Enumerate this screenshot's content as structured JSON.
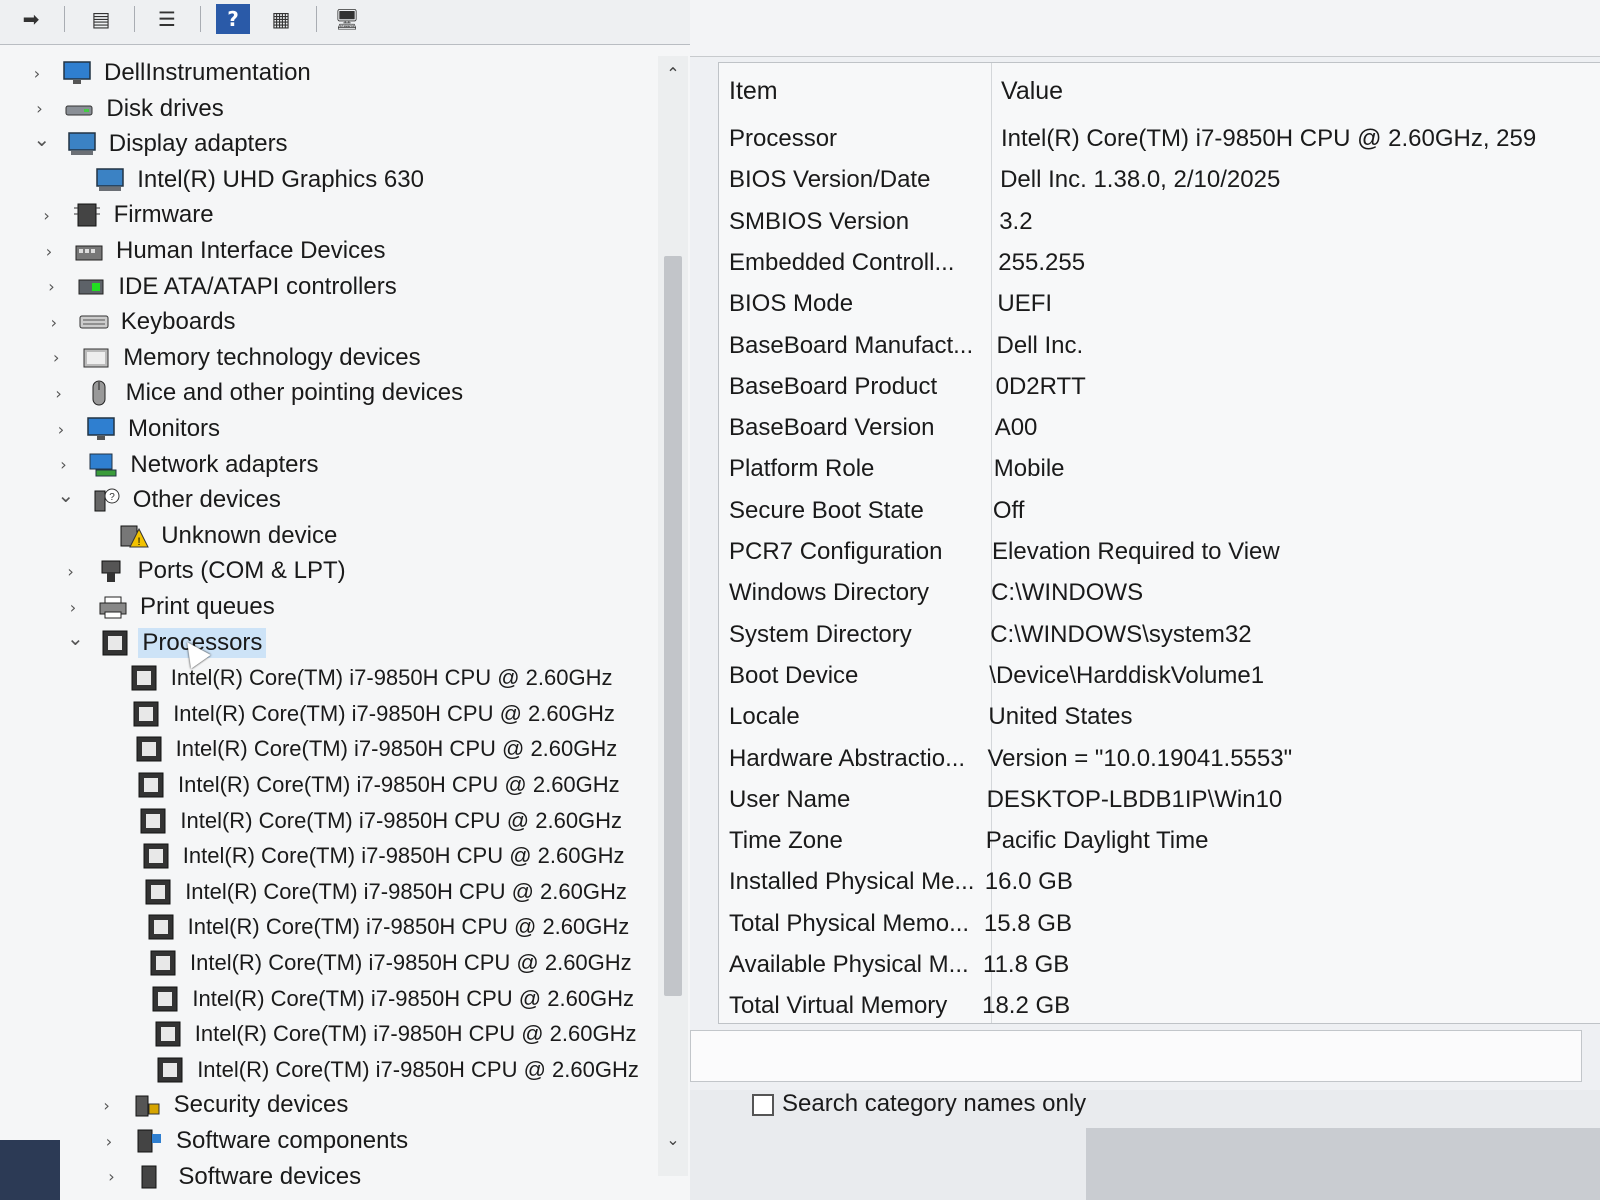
{
  "device_manager": {
    "toolbar": {
      "buttons": [
        {
          "name": "back-icon",
          "glyph": "➡"
        },
        {
          "name": "properties-icon",
          "glyph": "▤"
        },
        {
          "name": "list-icon",
          "glyph": "☰"
        },
        {
          "name": "help-icon",
          "glyph": "?"
        },
        {
          "name": "view-icon",
          "glyph": "▦"
        },
        {
          "name": "scan-hardware-icon",
          "glyph": "🖥"
        }
      ]
    },
    "tree": [
      {
        "label": "DellInstrumentation",
        "icon": "monitor-icon",
        "expanded": false,
        "child": false
      },
      {
        "label": "Disk drives",
        "icon": "disk-drive-icon",
        "expanded": false,
        "child": false
      },
      {
        "label": "Display adapters",
        "icon": "display-adapter-icon",
        "expanded": true,
        "child": false
      },
      {
        "label": "Intel(R) UHD Graphics 630",
        "icon": "display-adapter-icon",
        "child": true
      },
      {
        "label": "Firmware",
        "icon": "firmware-icon",
        "expanded": false,
        "child": false
      },
      {
        "label": "Human Interface Devices",
        "icon": "hid-icon",
        "expanded": false,
        "child": false
      },
      {
        "label": "IDE ATA/ATAPI controllers",
        "icon": "ide-controller-icon",
        "expanded": false,
        "child": false
      },
      {
        "label": "Keyboards",
        "icon": "keyboard-icon",
        "expanded": false,
        "child": false
      },
      {
        "label": "Memory technology devices",
        "icon": "memory-device-icon",
        "expanded": false,
        "child": false
      },
      {
        "label": "Mice and other pointing devices",
        "icon": "mouse-icon",
        "expanded": false,
        "child": false
      },
      {
        "label": "Monitors",
        "icon": "monitor-icon",
        "expanded": false,
        "child": false
      },
      {
        "label": "Network adapters",
        "icon": "network-adapter-icon",
        "expanded": false,
        "child": false
      },
      {
        "label": "Other devices",
        "icon": "other-devices-icon",
        "expanded": true,
        "child": false
      },
      {
        "label": "Unknown device",
        "icon": "unknown-device-warning-icon",
        "child": true
      },
      {
        "label": "Ports (COM & LPT)",
        "icon": "port-icon",
        "expanded": false,
        "child": false
      },
      {
        "label": "Print queues",
        "icon": "printer-icon",
        "expanded": false,
        "child": false
      },
      {
        "label": "Processors",
        "icon": "processor-icon",
        "expanded": true,
        "child": false,
        "selected": true
      },
      {
        "label": "Intel(R) Core(TM) i7-9850H CPU @ 2.60GHz",
        "icon": "processor-icon",
        "child": true
      },
      {
        "label": "Intel(R) Core(TM) i7-9850H CPU @ 2.60GHz",
        "icon": "processor-icon",
        "child": true
      },
      {
        "label": "Intel(R) Core(TM) i7-9850H CPU @ 2.60GHz",
        "icon": "processor-icon",
        "child": true
      },
      {
        "label": "Intel(R) Core(TM) i7-9850H CPU @ 2.60GHz",
        "icon": "processor-icon",
        "child": true
      },
      {
        "label": "Intel(R) Core(TM) i7-9850H CPU @ 2.60GHz",
        "icon": "processor-icon",
        "child": true
      },
      {
        "label": "Intel(R) Core(TM) i7-9850H CPU @ 2.60GHz",
        "icon": "processor-icon",
        "child": true
      },
      {
        "label": "Intel(R) Core(TM) i7-9850H CPU @ 2.60GHz",
        "icon": "processor-icon",
        "child": true
      },
      {
        "label": "Intel(R) Core(TM) i7-9850H CPU @ 2.60GHz",
        "icon": "processor-icon",
        "child": true
      },
      {
        "label": "Intel(R) Core(TM) i7-9850H CPU @ 2.60GHz",
        "icon": "processor-icon",
        "child": true
      },
      {
        "label": "Intel(R) Core(TM) i7-9850H CPU @ 2.60GHz",
        "icon": "processor-icon",
        "child": true
      },
      {
        "label": "Intel(R) Core(TM) i7-9850H CPU @ 2.60GHz",
        "icon": "processor-icon",
        "child": true
      },
      {
        "label": "Intel(R) Core(TM) i7-9850H CPU @ 2.60GHz",
        "icon": "processor-icon",
        "child": true
      },
      {
        "label": "Security devices",
        "icon": "security-device-icon",
        "expanded": false,
        "child": false
      },
      {
        "label": "Software components",
        "icon": "software-component-icon",
        "expanded": false,
        "child": false
      },
      {
        "label": "Software devices",
        "icon": "software-device-icon",
        "expanded": false,
        "child": false
      }
    ],
    "scroll": {
      "up_glyph": "⌃",
      "down_glyph": "⌄"
    }
  },
  "system_info": {
    "columns": {
      "item": "Item",
      "value": "Value"
    },
    "rows": [
      {
        "item": "Processor",
        "value": "Intel(R) Core(TM) i7-9850H CPU @ 2.60GHz, 259"
      },
      {
        "item": "BIOS Version/Date",
        "value": "Dell Inc. 1.38.0, 2/10/2025"
      },
      {
        "item": "SMBIOS Version",
        "value": "3.2"
      },
      {
        "item": "Embedded Controll...",
        "value": "255.255"
      },
      {
        "item": "BIOS Mode",
        "value": "UEFI"
      },
      {
        "item": "BaseBoard Manufact...",
        "value": "Dell Inc."
      },
      {
        "item": "BaseBoard Product",
        "value": "0D2RTT"
      },
      {
        "item": "BaseBoard Version",
        "value": "A00"
      },
      {
        "item": "Platform Role",
        "value": "Mobile"
      },
      {
        "item": "Secure Boot State",
        "value": "Off"
      },
      {
        "item": "PCR7 Configuration",
        "value": "Elevation Required to View"
      },
      {
        "item": "Windows Directory",
        "value": "C:\\WINDOWS"
      },
      {
        "item": "System Directory",
        "value": "C:\\WINDOWS\\system32"
      },
      {
        "item": "Boot Device",
        "value": "\\Device\\HarddiskVolume1"
      },
      {
        "item": "Locale",
        "value": "United States"
      },
      {
        "item": "Hardware Abstractio...",
        "value": "Version = \"10.0.19041.5553\""
      },
      {
        "item": "User Name",
        "value": "DESKTOP-LBDB1IP\\Win10"
      },
      {
        "item": "Time Zone",
        "value": "Pacific Daylight Time"
      },
      {
        "item": "Installed Physical Me...",
        "value": "16.0 GB"
      },
      {
        "item": "Total Physical Memo...",
        "value": "15.8 GB"
      },
      {
        "item": "Available Physical M...",
        "value": "11.8 GB"
      },
      {
        "item": "Total Virtual Memory",
        "value": "18.2 GB"
      }
    ],
    "search": {
      "checkbox_label": "Search category names only",
      "checked": false
    }
  },
  "colors": {
    "selection": "#cde3f7",
    "accent": "#1f5fa8"
  }
}
